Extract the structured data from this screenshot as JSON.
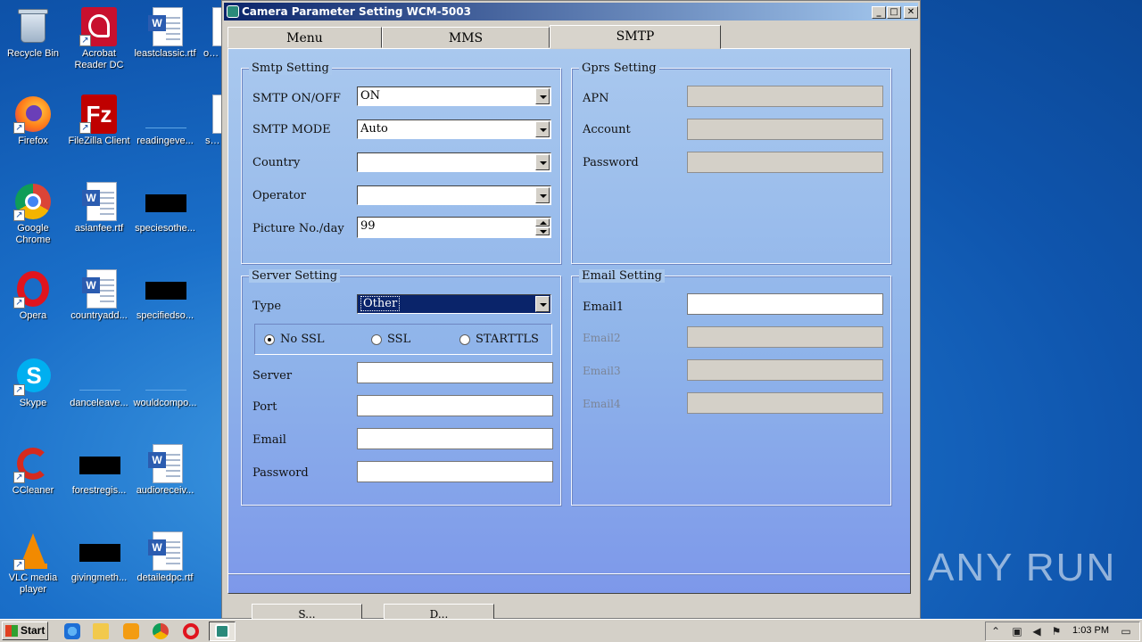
{
  "desktop": {
    "icons": [
      {
        "label": "Recycle Bin"
      },
      {
        "label": "Acrobat Reader DC"
      },
      {
        "label": "leastclassic.rtf"
      },
      {
        "label": "ove..."
      },
      {
        "label": "Firefox"
      },
      {
        "label": "FileZilla Client"
      },
      {
        "label": "readingeve..."
      },
      {
        "label": "sty..."
      },
      {
        "label": "Google Chrome"
      },
      {
        "label": "asianfee.rtf"
      },
      {
        "label": "speciesothe..."
      },
      {
        "label": "Opera"
      },
      {
        "label": "countryadd..."
      },
      {
        "label": "specifiedso..."
      },
      {
        "label": "Skype"
      },
      {
        "label": "danceleave..."
      },
      {
        "label": "wouldcompo..."
      },
      {
        "label": "CCleaner"
      },
      {
        "label": "forestregis..."
      },
      {
        "label": "audioreceiv..."
      },
      {
        "label": "VLC media player"
      },
      {
        "label": "givingmeth..."
      },
      {
        "label": "detailedpc.rtf"
      }
    ],
    "watermark": "ANY RUN"
  },
  "window": {
    "title": "Camera Parameter Setting WCM-5003",
    "controls": {
      "minimize": "_",
      "maximize": "□",
      "close": "✕"
    },
    "tabs": [
      {
        "label": "Menu",
        "active": false
      },
      {
        "label": "MMS",
        "active": false
      },
      {
        "label": "SMTP",
        "active": true
      }
    ],
    "smtp_setting": {
      "title": "Smtp Setting",
      "on_off_label": "SMTP ON/OFF",
      "on_off_value": "ON",
      "mode_label": "SMTP MODE",
      "mode_value": "Auto",
      "country_label": "Country",
      "country_value": "",
      "operator_label": "Operator",
      "operator_value": "",
      "picture_label": "Picture No./day",
      "picture_value": "99"
    },
    "gprs_setting": {
      "title": "Gprs Setting",
      "apn_label": "APN",
      "account_label": "Account",
      "password_label": "Password"
    },
    "server_setting": {
      "title": "Server Setting",
      "type_label": "Type",
      "type_value": "Other",
      "ssl_options": [
        {
          "label": "No SSL",
          "selected": true
        },
        {
          "label": "SSL",
          "selected": false
        },
        {
          "label": "STARTTLS",
          "selected": false
        }
      ],
      "server_label": "Server",
      "port_label": "Port",
      "email_label": "Email",
      "password_label": "Password"
    },
    "email_setting": {
      "title": "Email Setting",
      "email1_label": "Email1",
      "email2_label": "Email2",
      "email3_label": "Email3",
      "email4_label": "Email4"
    },
    "bottom_buttons": [
      "S...",
      "D..."
    ]
  },
  "taskbar": {
    "start_label": "Start",
    "clock": "1:03 PM"
  },
  "colors": {
    "title_active": "#0a246a",
    "panel_top": "#a9c8ee",
    "panel_bottom": "#7d98ea",
    "desktop": "#1a6fc9"
  }
}
